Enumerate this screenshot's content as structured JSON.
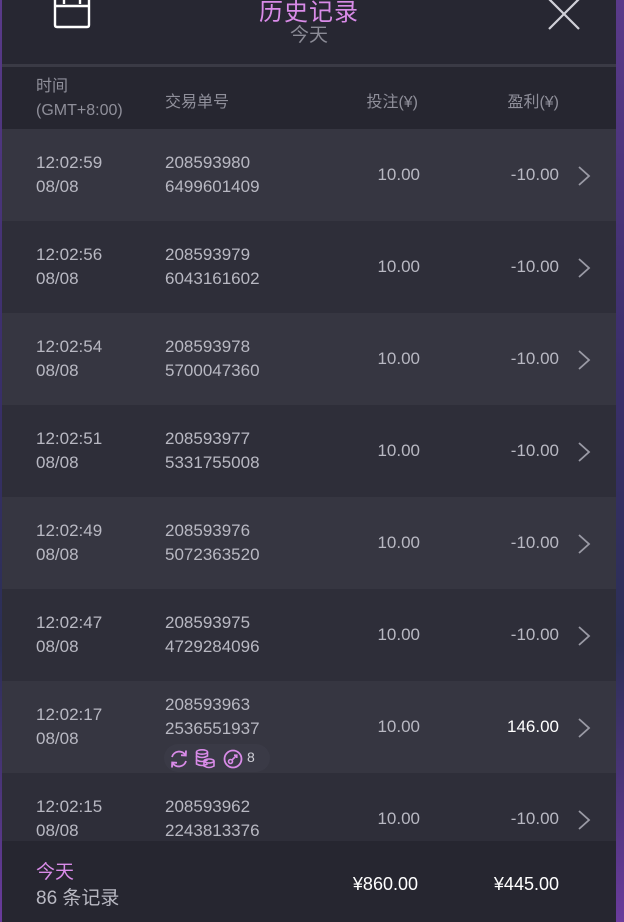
{
  "header": {
    "title": "历史记录",
    "subtitle": "今天"
  },
  "columns": {
    "time_line1": "时间",
    "time_line2": "(GMT+8:00)",
    "order": "交易单号",
    "bet": "投注(¥)",
    "profit": "盈利(¥)"
  },
  "rows": [
    {
      "time": "12:02:59",
      "date": "08/08",
      "order1": "208593980",
      "order2": "6499601409",
      "bet": "10.00",
      "profit": "-10.00"
    },
    {
      "time": "12:02:56",
      "date": "08/08",
      "order1": "208593979",
      "order2": "6043161602",
      "bet": "10.00",
      "profit": "-10.00"
    },
    {
      "time": "12:02:54",
      "date": "08/08",
      "order1": "208593978",
      "order2": "5700047360",
      "bet": "10.00",
      "profit": "-10.00"
    },
    {
      "time": "12:02:51",
      "date": "08/08",
      "order1": "208593977",
      "order2": "5331755008",
      "bet": "10.00",
      "profit": "-10.00"
    },
    {
      "time": "12:02:49",
      "date": "08/08",
      "order1": "208593976",
      "order2": "5072363520",
      "bet": "10.00",
      "profit": "-10.00"
    },
    {
      "time": "12:02:47",
      "date": "08/08",
      "order1": "208593975",
      "order2": "4729284096",
      "bet": "10.00",
      "profit": "-10.00"
    },
    {
      "time": "12:02:17",
      "date": "08/08",
      "order1": "208593963",
      "order2": "2536551937",
      "bet": "10.00",
      "profit": "146.00",
      "badge_count": "8"
    },
    {
      "time": "12:02:15",
      "date": "08/08",
      "order1": "208593962",
      "order2": "2243813376",
      "bet": "10.00",
      "profit": "-10.00"
    }
  ],
  "footer": {
    "label": "今天",
    "count": "86 条记录",
    "total_bet": "¥860.00",
    "total_profit": "¥445.00"
  },
  "colors": {
    "accent": "#d98be8",
    "panel": "#2c2c38"
  },
  "icons": [
    "calendar-icon",
    "close-icon",
    "chevron-right-icon",
    "respin-icon",
    "coins-icon",
    "free-spin-icon"
  ]
}
